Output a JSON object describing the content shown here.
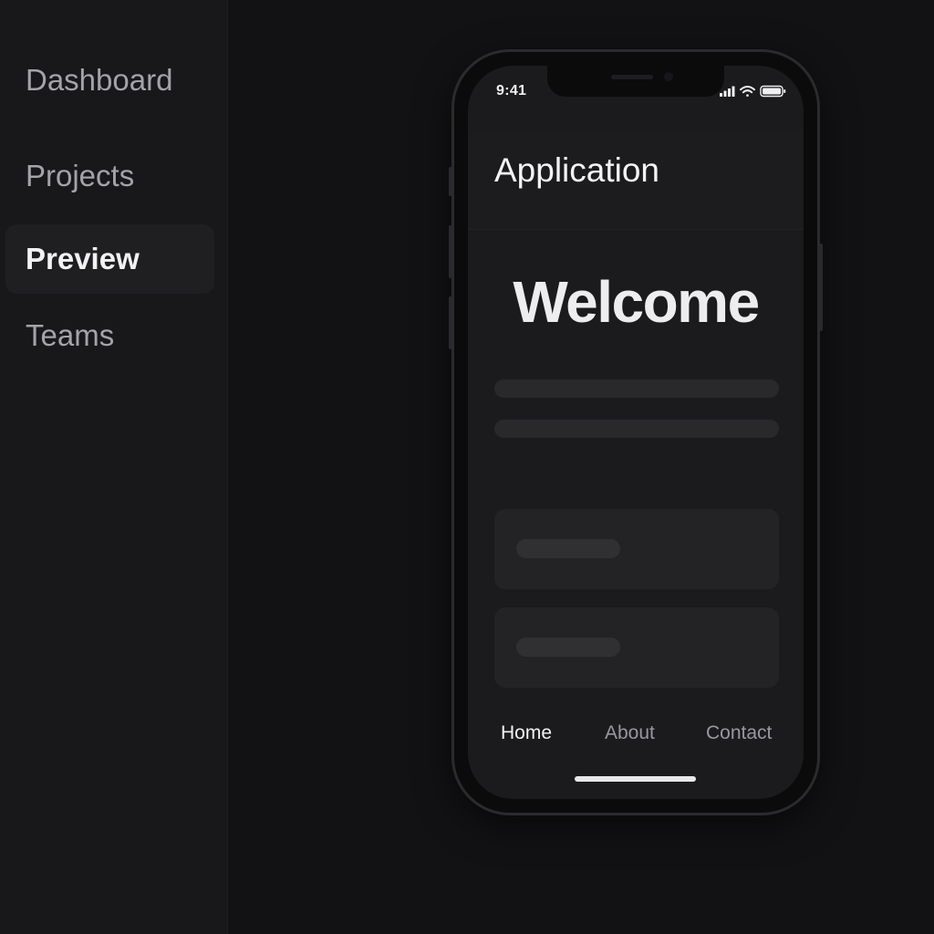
{
  "sidebar": {
    "items": [
      {
        "label": "Dashboard",
        "active": false
      },
      {
        "label": "Projects",
        "active": false
      },
      {
        "label": "Preview",
        "active": true
      },
      {
        "label": "Teams",
        "active": false
      }
    ]
  },
  "phone": {
    "status_bar": {
      "time": "9:41",
      "icons": [
        "signal-icon",
        "wifi-icon",
        "battery-icon"
      ]
    },
    "header": {
      "title": "Application"
    },
    "hero": {
      "heading": "Welcome"
    },
    "tabs": [
      {
        "label": "Home",
        "active": true
      },
      {
        "label": "About",
        "active": false
      },
      {
        "label": "Contact",
        "active": false
      }
    ]
  },
  "colors": {
    "page_background": "#121214",
    "sidebar_background": "#18181a",
    "screen_background": "#1b1b1d",
    "text_primary": "#f3f3f5",
    "text_muted": "#a3a3a8"
  }
}
